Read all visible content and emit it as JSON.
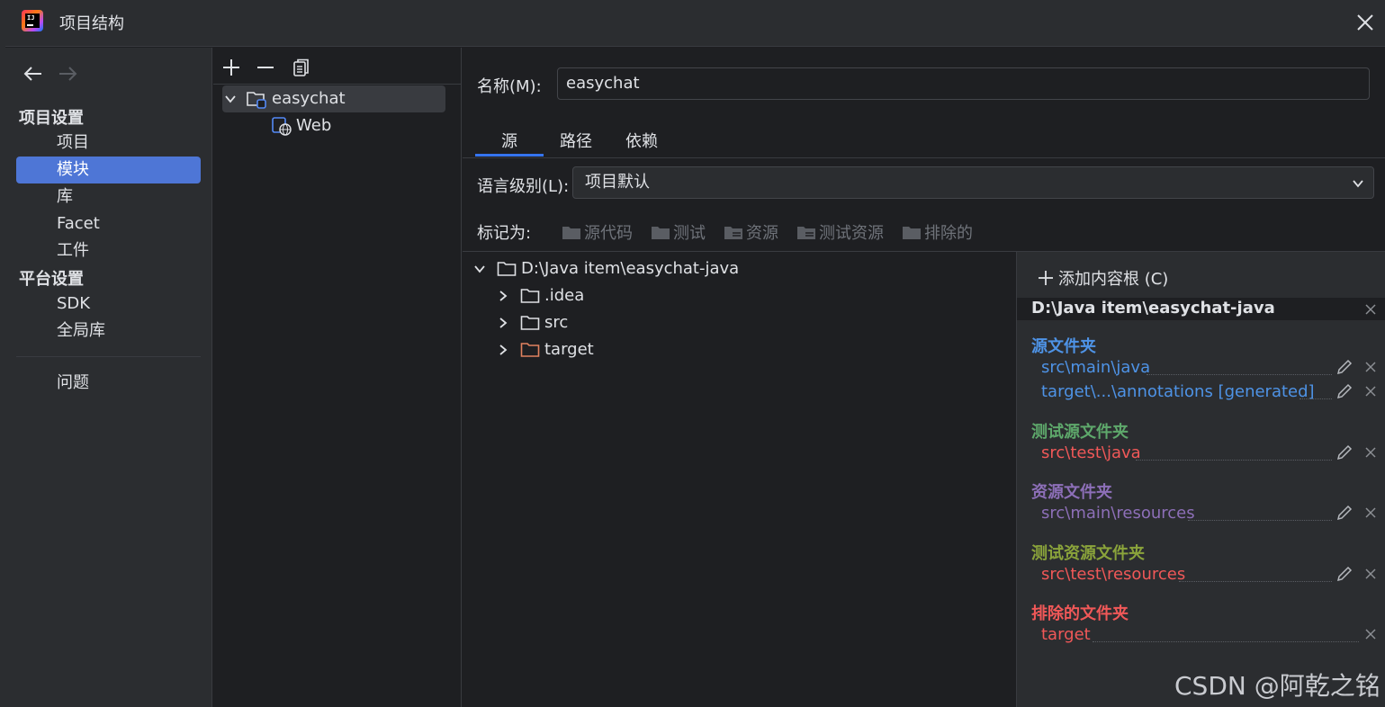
{
  "window": {
    "title": "项目结构"
  },
  "sidebar": {
    "groups": [
      {
        "label": "项目设置",
        "items": [
          "项目",
          "模块",
          "库",
          "Facet",
          "工件"
        ]
      },
      {
        "label": "平台设置",
        "items": [
          "SDK",
          "全局库"
        ]
      }
    ],
    "problems": "问题",
    "selected": "模块"
  },
  "modules": {
    "tree": [
      {
        "label": "easychat",
        "children": [
          "Web"
        ]
      }
    ]
  },
  "module": {
    "name_label": "名称(M):",
    "name_value": "easychat",
    "tabs": [
      "源",
      "路径",
      "依赖"
    ],
    "active_tab": "源",
    "language_label": "语言级别(L):",
    "language_value": "项目默认",
    "mark_label": "标记为:",
    "mark_options": [
      "源代码",
      "测试",
      "资源",
      "测试资源",
      "排除的"
    ]
  },
  "content_tree": {
    "root": "D:\\Java item\\easychat-java",
    "children": [
      ".idea",
      "src",
      "target"
    ]
  },
  "content_roots": {
    "add_label": "添加内容根 (C)",
    "root_path": "D:\\Java item\\easychat-java",
    "categories": [
      {
        "title": "源文件夹",
        "color": "#4e93e6",
        "entries": [
          "src\\main\\java",
          "target\\...\\annotations [generated]"
        ]
      },
      {
        "title": "测试源文件夹",
        "color": "#5ea86b",
        "entries": [
          "src\\test\\java"
        ]
      },
      {
        "title": "资源文件夹",
        "color": "#8d6fb8",
        "entries": [
          "src\\main\\resources"
        ]
      },
      {
        "title": "测试资源文件夹",
        "color": "#8aa33b",
        "entries": [
          "src\\test\\resources"
        ]
      },
      {
        "title": "排除的文件夹",
        "color": "#f05858",
        "entries": [
          "target"
        ]
      }
    ]
  },
  "watermark": "CSDN @阿乾之铭",
  "colors": {
    "accent": "#3574f0",
    "selection": "#4e76d6",
    "excluded_entry": "#f05858",
    "target_folder": "#e0825f"
  }
}
